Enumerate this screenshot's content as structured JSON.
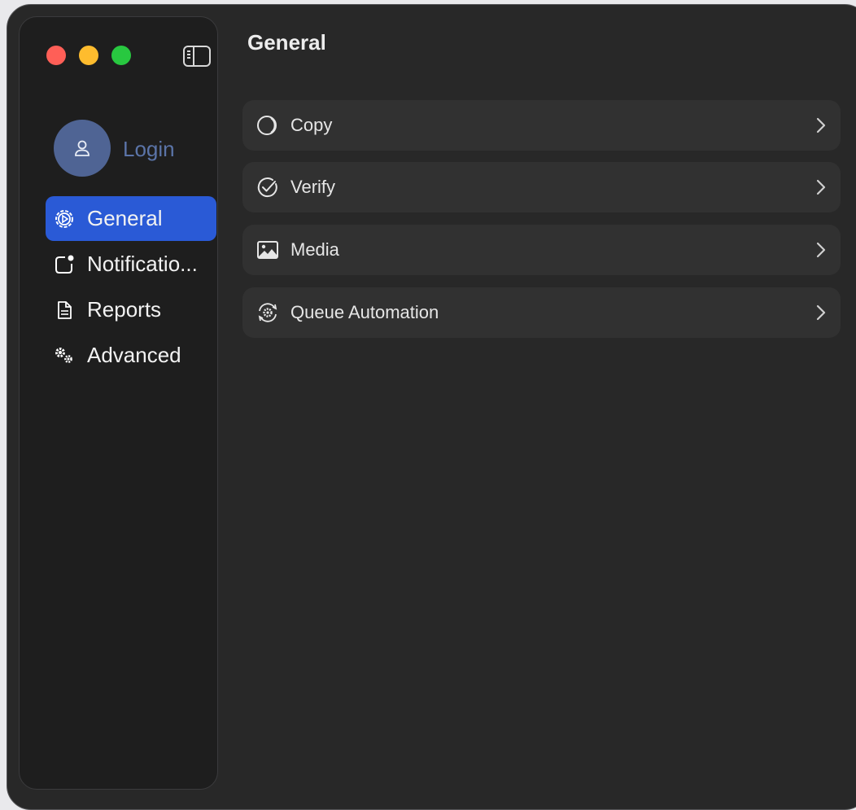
{
  "window": {
    "traffic_lights": [
      "close",
      "minimize",
      "zoom"
    ],
    "sidebar_toggle_icon": "sidebar-left-icon"
  },
  "account": {
    "login_label": "Login",
    "avatar_icon": "person-icon"
  },
  "sidebar": {
    "items": [
      {
        "label": "General",
        "icon": "gear-icon",
        "selected": true
      },
      {
        "label": "Notificatio...",
        "icon": "notification-badge-icon",
        "selected": false
      },
      {
        "label": "Reports",
        "icon": "document-icon",
        "selected": false
      },
      {
        "label": "Advanced",
        "icon": "gears-icon",
        "selected": false
      }
    ]
  },
  "main": {
    "title": "General",
    "rows": [
      {
        "label": "Copy",
        "icon": "copy-circles-icon"
      },
      {
        "label": "Verify",
        "icon": "checkmark-circle-icon"
      },
      {
        "label": "Media",
        "icon": "photo-icon"
      },
      {
        "label": "Queue Automation",
        "icon": "gear-arrows-icon"
      }
    ]
  },
  "colors": {
    "window_bg": "#282828",
    "sidebar_bg": "#1e1e1e",
    "row_bg": "#313131",
    "accent": "#2a5ad6",
    "avatar_bg": "#4f6494",
    "login_text": "#5b74a8",
    "traffic_red": "#ff5f57",
    "traffic_yellow": "#febc2e",
    "traffic_green": "#28c840"
  }
}
